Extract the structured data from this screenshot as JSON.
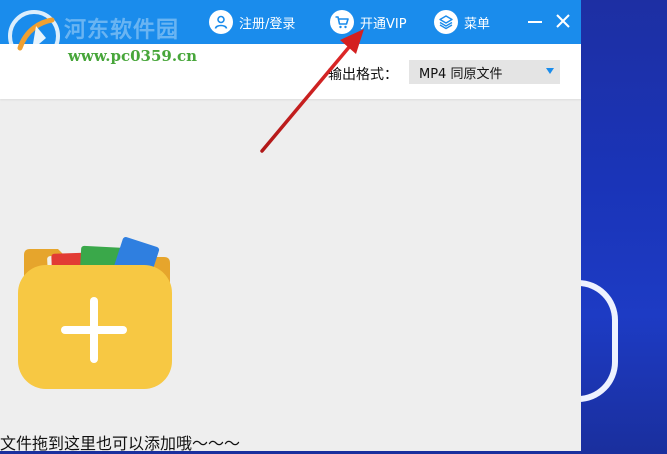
{
  "watermark": {
    "site_name": "河东软件园",
    "url": "www.pc0359.cn"
  },
  "titlebar": {
    "login_label": "注册/登录",
    "vip_label": "开通VIP",
    "menu_label": "菜单",
    "minimize_label": "—",
    "close_label": "✕"
  },
  "toolbar": {
    "format_label": "输出格式：",
    "format_value": "MP4  同原文件"
  },
  "main": {
    "drop_hint": "文件拖到这里也可以添加哦～～～"
  },
  "colors": {
    "titlebar": "#1a8cec",
    "accent_green": "#47a63a",
    "folder_yellow": "#f7c843",
    "arrow_red": "#d42020"
  }
}
